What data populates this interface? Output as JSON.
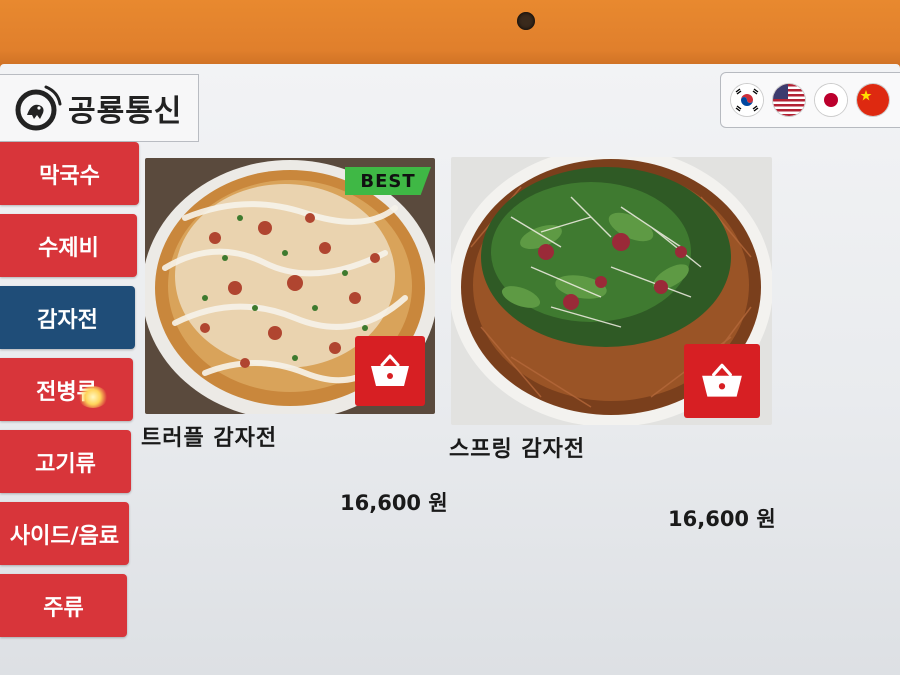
{
  "app": {
    "title": "공룡통신",
    "logo_icon": "dinosaur-wifi-logo"
  },
  "languages": [
    {
      "name": "Korean",
      "icon": "flag-kr-icon"
    },
    {
      "name": "English",
      "icon": "flag-us-icon"
    },
    {
      "name": "Japanese",
      "icon": "flag-jp-icon"
    },
    {
      "name": "Chinese",
      "icon": "flag-cn-icon"
    }
  ],
  "categories": [
    {
      "label": "막국수",
      "active": false
    },
    {
      "label": "수제비",
      "active": false
    },
    {
      "label": "감자전",
      "active": true
    },
    {
      "label": "전병류",
      "active": false
    },
    {
      "label": "고기류",
      "active": false
    },
    {
      "label": "사이드/음료",
      "active": false
    },
    {
      "label": "주류",
      "active": false
    }
  ],
  "menu_items": [
    {
      "name": "트러플 감자전",
      "price": "16,600 원",
      "badge": "BEST",
      "cart_icon": "basket-icon"
    },
    {
      "name": "스프링 감자전",
      "price": "16,600 원",
      "badge": "",
      "cart_icon": "basket-icon"
    }
  ],
  "colors": {
    "category_bg": "#d8353a",
    "category_active_bg": "#1f4d78",
    "cart_button": "#d71f23",
    "best_badge": "#3fb845",
    "bezel": "#e2802e"
  }
}
